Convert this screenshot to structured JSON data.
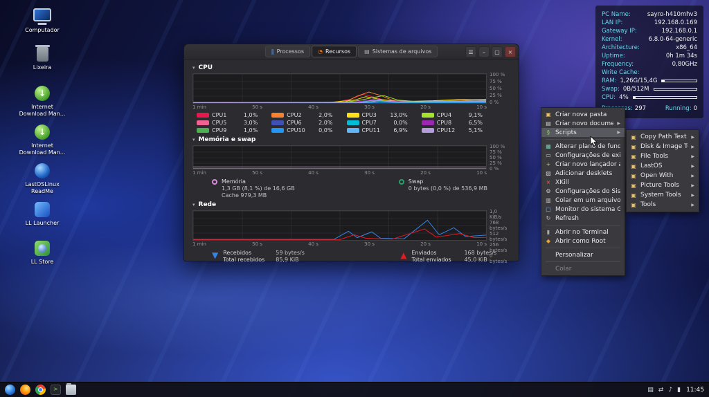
{
  "icons": {
    "chevron_down": "▾",
    "arrow_down": "▼",
    "arrow_up": "▲",
    "submenu_arrow": "▶",
    "folder_glyph": "▣"
  },
  "desktop": {
    "icons": [
      {
        "id": "computer",
        "label": "Computador"
      },
      {
        "id": "trash",
        "label": "Lixeira"
      },
      {
        "id": "idm",
        "label": "Internet Download Man..."
      },
      {
        "id": "idm",
        "label": "Internet Download Man..."
      },
      {
        "id": "readme",
        "label": "LastOSLinux ReadMe"
      },
      {
        "id": "launcher",
        "label": "LL Launcher"
      },
      {
        "id": "store",
        "label": "LL Store"
      }
    ]
  },
  "conky": {
    "rows": [
      {
        "label": "PC Name:",
        "value": "sayro-h410mhv3"
      },
      {
        "label": "LAN IP:",
        "value": "192.168.0.169"
      },
      {
        "label": "Gateway IP:",
        "value": "192.168.0.1"
      },
      {
        "label": "Kernel:",
        "value": "6.8.0-64-generic"
      },
      {
        "label": "Architecture:",
        "value": "x86_64"
      },
      {
        "label": "Uptime:",
        "value": "0h 1m 34s"
      },
      {
        "label": "Frequency:",
        "value": "0,80GHz"
      },
      {
        "label": "Write Cache:",
        "value": ""
      }
    ],
    "bars": [
      {
        "label": "RAM:",
        "value": "1,26G/15,4G",
        "pct": 8
      },
      {
        "label": "Swap:",
        "value": "0B/512M",
        "pct": 0
      },
      {
        "label": "CPU:",
        "value": "4%",
        "pct": 4
      }
    ],
    "proc_label": "Processes:",
    "proc_value": "297",
    "run_label": "Running:",
    "run_value": "0",
    "accent_color": "#6fd3e6"
  },
  "monitor": {
    "tabs": [
      {
        "label": "Processos",
        "glyph": "‖"
      },
      {
        "label": "Recursos",
        "glyph": "◔"
      },
      {
        "label": "Sistemas de arquivos",
        "glyph": "▤"
      }
    ],
    "window_controls": {
      "menu": "☰",
      "minimize": "–",
      "maximize": "▢",
      "close": "×"
    },
    "cpu": {
      "title": "CPU",
      "y_labels": [
        "100 %",
        "75 %",
        "50 %",
        "25 %",
        "0 %"
      ],
      "x_labels": [
        "1 min",
        "50 s",
        "40 s",
        "30 s",
        "20 s",
        "10 s"
      ],
      "legend": [
        {
          "name": "CPU1",
          "value": "1,0%",
          "color": "#e6194b"
        },
        {
          "name": "CPU2",
          "value": "2,0%",
          "color": "#f58231"
        },
        {
          "name": "CPU3",
          "value": "13,0%",
          "color": "#ffe119"
        },
        {
          "name": "CPU4",
          "value": "9,1%",
          "color": "#a6e22e"
        },
        {
          "name": "CPU5",
          "value": "3,0%",
          "color": "#f06292"
        },
        {
          "name": "CPU6",
          "value": "2,0%",
          "color": "#3f51b5"
        },
        {
          "name": "CPU7",
          "value": "0,0%",
          "color": "#00bcd4"
        },
        {
          "name": "CPU8",
          "value": "6,5%",
          "color": "#9c27b0"
        },
        {
          "name": "CPU9",
          "value": "1,0%",
          "color": "#4caf50"
        },
        {
          "name": "CPU10",
          "value": "0,0%",
          "color": "#2196f3"
        },
        {
          "name": "CPU11",
          "value": "6,9%",
          "color": "#64b5f6"
        },
        {
          "name": "CPU12",
          "value": "5,1%",
          "color": "#b39ddb"
        }
      ],
      "series": [
        {
          "name": "CPU1",
          "color": "#e6194b",
          "points": [
            [
              0,
              2
            ],
            [
              35,
              1
            ],
            [
              48,
              2
            ],
            [
              54,
              14
            ],
            [
              58,
              30
            ],
            [
              62,
              20
            ],
            [
              66,
              8
            ],
            [
              72,
              3
            ],
            [
              80,
              5
            ],
            [
              88,
              8
            ],
            [
              94,
              4
            ],
            [
              100,
              6
            ]
          ]
        },
        {
          "name": "CPU2",
          "color": "#f58231",
          "points": [
            [
              0,
              1
            ],
            [
              40,
              2
            ],
            [
              52,
              4
            ],
            [
              56,
              24
            ],
            [
              60,
              38
            ],
            [
              64,
              26
            ],
            [
              68,
              10
            ],
            [
              75,
              4
            ],
            [
              85,
              7
            ],
            [
              92,
              10
            ],
            [
              100,
              5
            ]
          ]
        },
        {
          "name": "CPU3",
          "color": "#ffe119",
          "points": [
            [
              0,
              1
            ],
            [
              45,
              1
            ],
            [
              55,
              10
            ],
            [
              59,
              22
            ],
            [
              63,
              14
            ],
            [
              70,
              5
            ],
            [
              82,
              8
            ],
            [
              90,
              12
            ],
            [
              100,
              13
            ]
          ]
        },
        {
          "name": "CPU4",
          "color": "#a6e22e",
          "points": [
            [
              0,
              2
            ],
            [
              50,
              2
            ],
            [
              56,
              8
            ],
            [
              61,
              18
            ],
            [
              65,
              26
            ],
            [
              70,
              10
            ],
            [
              78,
              4
            ],
            [
              90,
              6
            ],
            [
              100,
              9
            ]
          ]
        },
        {
          "name": "CPU5",
          "color": "#f06292",
          "points": [
            [
              0,
              1
            ],
            [
              54,
              2
            ],
            [
              60,
              10
            ],
            [
              65,
              5
            ],
            [
              100,
              3
            ]
          ]
        },
        {
          "name": "CPU6",
          "color": "#3f51b5",
          "points": [
            [
              0,
              1
            ],
            [
              56,
              2
            ],
            [
              62,
              14
            ],
            [
              67,
              4
            ],
            [
              100,
              2
            ]
          ]
        },
        {
          "name": "CPU7",
          "color": "#00bcd4",
          "points": [
            [
              0,
              0
            ],
            [
              60,
              1
            ],
            [
              64,
              6
            ],
            [
              70,
              2
            ],
            [
              100,
              1
            ]
          ]
        },
        {
          "name": "CPU8",
          "color": "#9c27b0",
          "points": [
            [
              0,
              2
            ],
            [
              55,
              3
            ],
            [
              61,
              12
            ],
            [
              66,
              6
            ],
            [
              85,
              3
            ],
            [
              100,
              6
            ]
          ]
        },
        {
          "name": "CPU9",
          "color": "#4caf50",
          "points": [
            [
              0,
              1
            ],
            [
              58,
              2
            ],
            [
              63,
              8
            ],
            [
              70,
              2
            ],
            [
              100,
              1
            ]
          ]
        },
        {
          "name": "CPU10",
          "color": "#2196f3",
          "points": [
            [
              0,
              0
            ],
            [
              100,
              1
            ]
          ]
        },
        {
          "name": "CPU11",
          "color": "#64b5f6",
          "points": [
            [
              0,
              2
            ],
            [
              57,
              3
            ],
            [
              62,
              10
            ],
            [
              68,
              4
            ],
            [
              88,
              6
            ],
            [
              100,
              7
            ]
          ]
        },
        {
          "name": "CPU12",
          "color": "#b39ddb",
          "points": [
            [
              0,
              1
            ],
            [
              59,
              2
            ],
            [
              64,
              9
            ],
            [
              70,
              3
            ],
            [
              100,
              5
            ]
          ]
        }
      ]
    },
    "memory": {
      "title": "Memória e swap",
      "y_labels": [
        "100 %",
        "75 %",
        "50 %",
        "25 %",
        "0 %"
      ],
      "x_labels": [
        "1 min",
        "50 s",
        "40 s",
        "30 s",
        "20 s",
        "10 s"
      ],
      "memory_label": "Memória",
      "memory_value": "1,3 GB (8,1 %) de 16,6 GB",
      "memory_cache": "Cache 979,3 MB",
      "swap_label": "Swap",
      "swap_value": "0 bytes (0,0 %) de 536,9 MB",
      "series": [
        {
          "name": "memory",
          "color": "#dc8add",
          "points": [
            [
              0,
              8
            ],
            [
              100,
              8
            ]
          ]
        },
        {
          "name": "swap",
          "color": "#26a269",
          "points": [
            [
              0,
              1
            ],
            [
              100,
              1
            ]
          ]
        }
      ]
    },
    "network": {
      "title": "Rede",
      "y_labels": [
        "1,0 KiB/s",
        "768 bytes/s",
        "512 bytes/s",
        "256 bytes/s",
        "0 bytes/s"
      ],
      "x_labels": [
        "1 min",
        "50 s",
        "40 s",
        "30 s",
        "20 s",
        "10 s"
      ],
      "received_label": "Recebidos",
      "received_rate": "59 bytes/s",
      "received_total_label": "Total recebidos",
      "received_total": "85,9 KiB",
      "sent_label": "Enviados",
      "sent_rate": "168 bytes/s",
      "sent_total_label": "Total enviados",
      "sent_total": "45,0 KiB",
      "series": [
        {
          "name": "received",
          "color": "#3584e4",
          "points": [
            [
              0,
              2
            ],
            [
              48,
              2
            ],
            [
              53,
              30
            ],
            [
              56,
              8
            ],
            [
              61,
              28
            ],
            [
              64,
              6
            ],
            [
              72,
              4
            ],
            [
              80,
              68
            ],
            [
              84,
              18
            ],
            [
              89,
              42
            ],
            [
              93,
              12
            ],
            [
              100,
              17
            ]
          ]
        },
        {
          "name": "sent",
          "color": "#e01b24",
          "points": [
            [
              0,
              1
            ],
            [
              50,
              1
            ],
            [
              55,
              18
            ],
            [
              59,
              6
            ],
            [
              68,
              3
            ],
            [
              79,
              38
            ],
            [
              83,
              10
            ],
            [
              91,
              22
            ],
            [
              96,
              8
            ],
            [
              100,
              9
            ]
          ]
        }
      ]
    }
  },
  "context_menu": {
    "items": [
      {
        "label": "Criar nova pasta",
        "icon": "new-folder-icon",
        "glyph": "▣",
        "color": "#e8c16a"
      },
      {
        "label": "Criar novo documento",
        "icon": "new-document-icon",
        "glyph": "▤",
        "color": "#cccccc",
        "submenu": true
      },
      {
        "label": "Scripts",
        "icon": "scripts-icon",
        "glyph": "§",
        "color": "#9fd36a",
        "submenu": true,
        "highlight": true
      },
      {
        "separator": true
      },
      {
        "label": "Alterar plano de fundo",
        "icon": "wallpaper-icon",
        "glyph": "▦",
        "color": "#6fc7b0"
      },
      {
        "label": "Configurações de exibição",
        "icon": "display-settings-icon",
        "glyph": "▭",
        "color": "#cccccc"
      },
      {
        "label": "Criar novo lançador aqui...",
        "icon": "new-launcher-icon",
        "glyph": "+",
        "color": "#9fd36a"
      },
      {
        "label": "Adicionar desklets",
        "icon": "desklets-icon",
        "glyph": "▧",
        "color": "#cccccc"
      },
      {
        "label": "XKill",
        "icon": "xkill-icon",
        "glyph": "×",
        "color": "#e06666"
      },
      {
        "label": "Configurações do Sistema",
        "icon": "system-settings-icon",
        "glyph": "⚙",
        "color": "#cccccc"
      },
      {
        "label": "Colar em um arquivo",
        "icon": "paste-into-file-icon",
        "glyph": "▥",
        "color": "#cccccc"
      },
      {
        "label": "Monitor do sistema GNOME",
        "icon": "system-monitor-icon",
        "glyph": "▢",
        "color": "#8ab4f8"
      },
      {
        "label": "Refresh",
        "icon": "refresh-icon",
        "glyph": "↻",
        "color": "#cccccc"
      },
      {
        "separator": true
      },
      {
        "label": "Abrir no Terminal",
        "icon": "terminal-icon",
        "glyph": "▮",
        "color": "#aaaaaa"
      },
      {
        "label": "Abrir como Root",
        "icon": "root-icon",
        "glyph": "◆",
        "color": "#e8a33d"
      },
      {
        "separator": true
      },
      {
        "label": "Personalizar",
        "icon": "customize-icon",
        "glyph": "",
        "color": "#cccccc"
      },
      {
        "separator": true
      },
      {
        "label": "Colar",
        "icon": "paste-icon",
        "glyph": "",
        "color": "#888888",
        "disabled": true
      }
    ]
  },
  "submenu": {
    "items": [
      {
        "label": "Copy Path Text"
      },
      {
        "label": "Disk & Image Tools"
      },
      {
        "label": "File Tools"
      },
      {
        "label": "LastOS"
      },
      {
        "label": "Open With"
      },
      {
        "label": "Picture Tools"
      },
      {
        "label": "System Tools"
      },
      {
        "label": "Tools"
      }
    ]
  },
  "taskbar": {
    "apps": [
      {
        "name": "lastos-menu-icon",
        "class": "app-lastos"
      },
      {
        "name": "firefox-icon",
        "class": "app-firefox"
      },
      {
        "name": "chrome-icon",
        "class": "app-chrome"
      },
      {
        "name": "terminal-app-icon",
        "class": "app-terminal"
      },
      {
        "name": "file-manager-icon",
        "class": "app-files"
      }
    ],
    "tray": [
      {
        "name": "notifications-icon",
        "glyph": "▤"
      },
      {
        "name": "network-icon",
        "glyph": "⇄"
      },
      {
        "name": "volume-icon",
        "glyph": "♪"
      },
      {
        "name": "power-icon",
        "glyph": "▮"
      }
    ],
    "clock": "11:45"
  }
}
